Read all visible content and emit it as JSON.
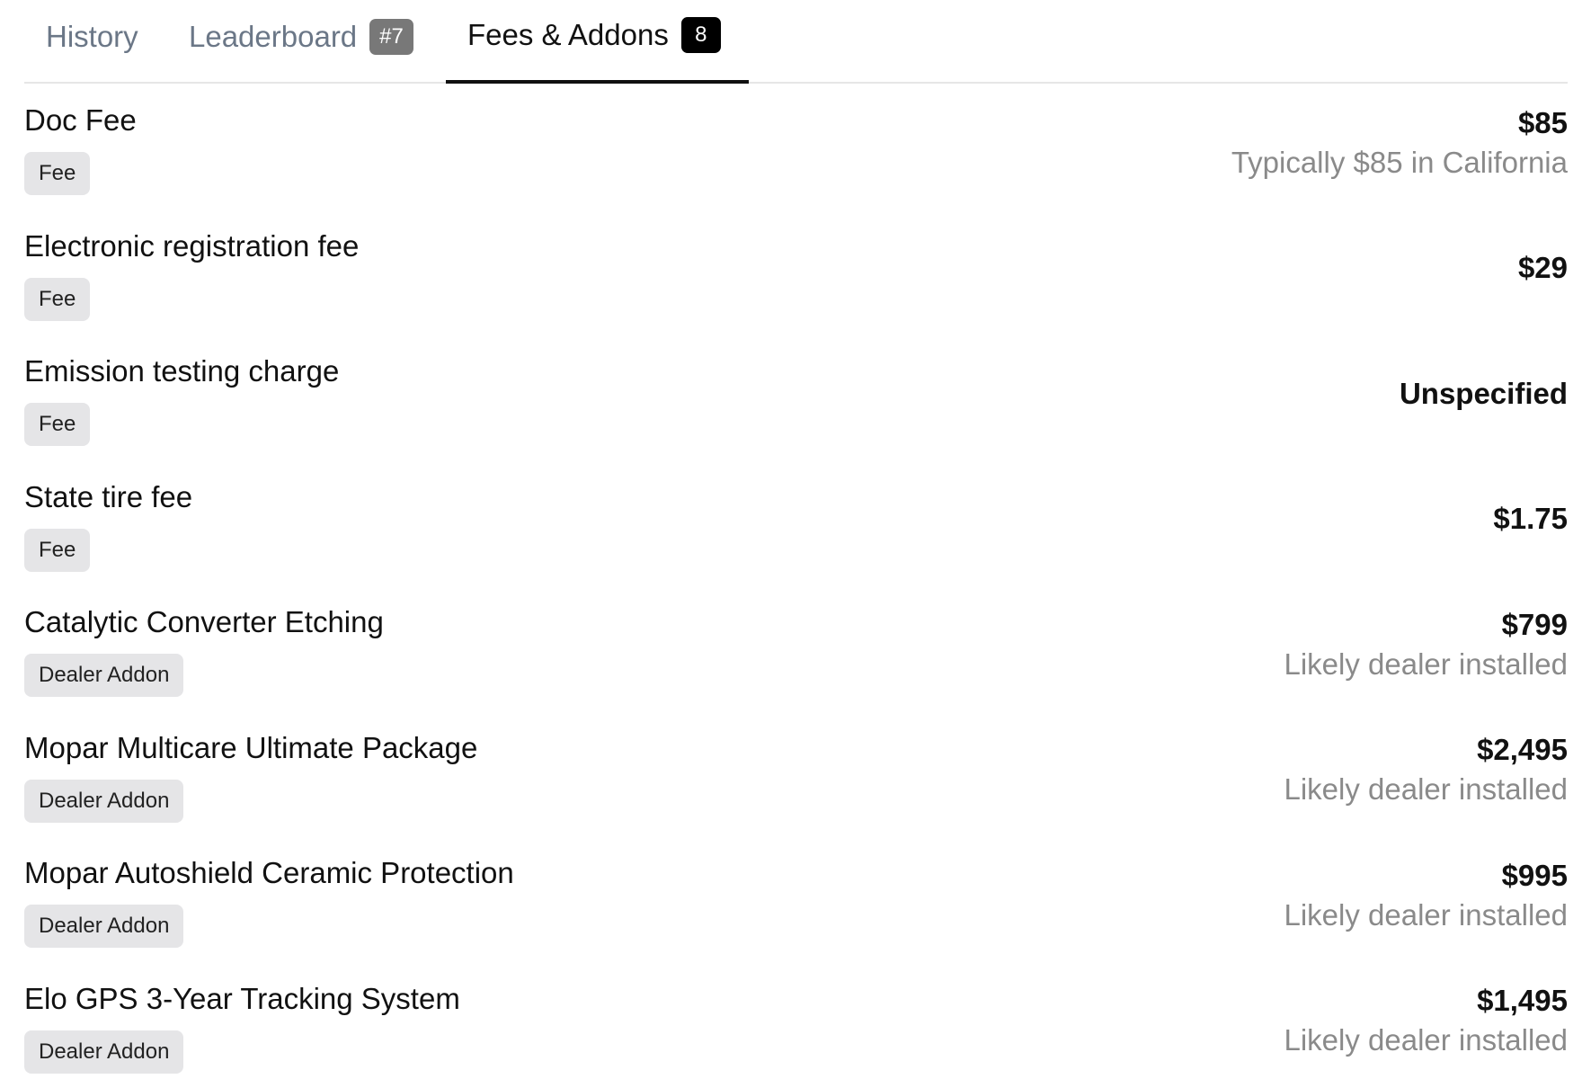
{
  "tabs": {
    "history": {
      "label": "History"
    },
    "leaderboard": {
      "label": "Leaderboard",
      "badge": "#7"
    },
    "fees": {
      "label": "Fees & Addons",
      "badge": "8"
    }
  },
  "items": [
    {
      "name": "Doc Fee",
      "tag": "Fee",
      "price": "$85",
      "note": "Typically $85 in California"
    },
    {
      "name": "Electronic registration fee",
      "tag": "Fee",
      "price": "$29",
      "note": ""
    },
    {
      "name": "Emission testing charge",
      "tag": "Fee",
      "price": "Unspecified",
      "note": ""
    },
    {
      "name": "State tire fee",
      "tag": "Fee",
      "price": "$1.75",
      "note": ""
    },
    {
      "name": "Catalytic Converter Etching",
      "tag": "Dealer Addon",
      "price": "$799",
      "note": "Likely dealer installed"
    },
    {
      "name": "Mopar Multicare Ultimate Package",
      "tag": "Dealer Addon",
      "price": "$2,495",
      "note": "Likely dealer installed"
    },
    {
      "name": "Mopar Autoshield Ceramic Protection",
      "tag": "Dealer Addon",
      "price": "$995",
      "note": "Likely dealer installed"
    },
    {
      "name": "Elo GPS 3-Year Tracking System",
      "tag": "Dealer Addon",
      "price": "$1,495",
      "note": "Likely dealer installed"
    }
  ]
}
